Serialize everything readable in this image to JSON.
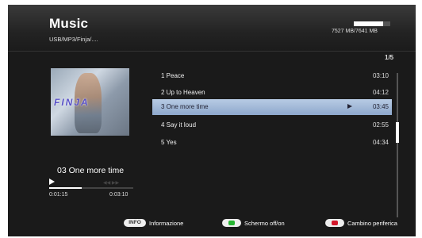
{
  "header": {
    "title": "Music",
    "path": "USB/MP3/Finja/....",
    "storage": {
      "text": "7527 MB/7641 MB",
      "used_fraction": 0.8
    }
  },
  "pagination": "1/5",
  "now_playing": {
    "title": "03 One more time",
    "elapsed": "0:01:15",
    "total": "0:03:10",
    "progress_fraction": 0.39
  },
  "album_logo": "FINJA",
  "tracks": [
    {
      "name": "1 Peace",
      "duration": "03:10",
      "selected": false
    },
    {
      "name": "2 Up to Heaven",
      "duration": "04:12",
      "selected": false
    },
    {
      "name": "3 One more time",
      "duration": "03:45",
      "selected": true
    },
    {
      "name": "4 Say it loud",
      "duration": "02:55",
      "selected": false
    },
    {
      "name": "5 Yes",
      "duration": "04:34",
      "selected": false
    }
  ],
  "footer": {
    "info_badge": "INFO",
    "info_label": "Informazione",
    "green_label": "Schermo off/on",
    "red_label": "Cambino periferica"
  },
  "colors": {
    "green_button": "#27b532",
    "red_button": "#d3172b",
    "selection": "#a4bbdb"
  }
}
